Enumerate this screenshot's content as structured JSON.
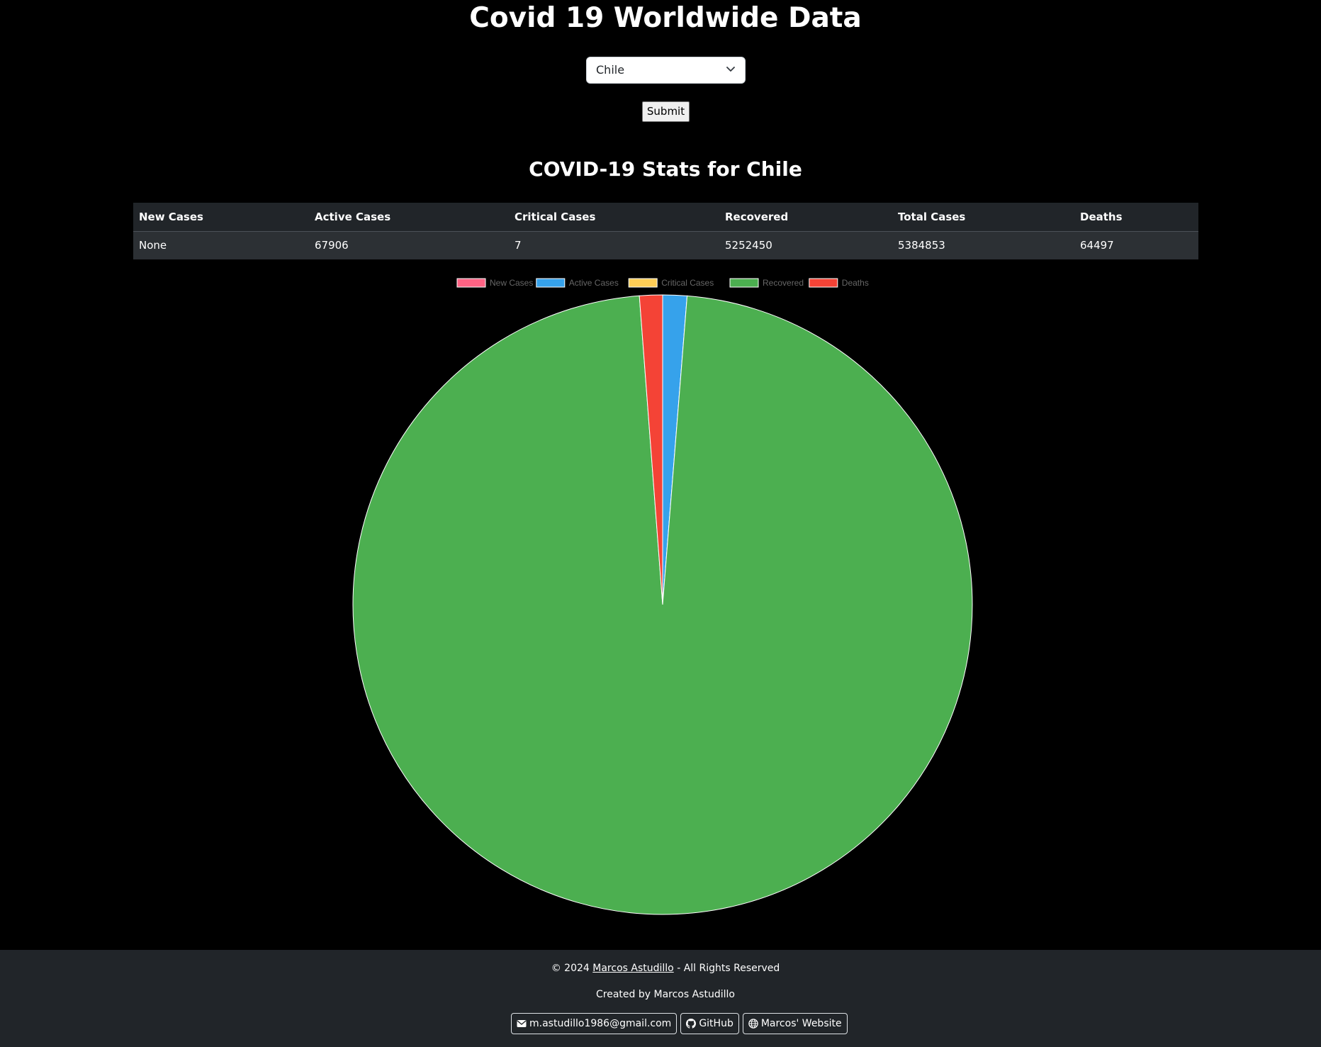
{
  "header": {
    "title": "Covid 19 Worldwide Data"
  },
  "form": {
    "selected_country": "Chile",
    "submit_label": "Submit"
  },
  "stats": {
    "title": "COVID-19 Stats for Chile",
    "columns": [
      "New Cases",
      "Active Cases",
      "Critical Cases",
      "Recovered",
      "Total Cases",
      "Deaths"
    ],
    "row": [
      "None",
      "67906",
      "7",
      "5252450",
      "5384853",
      "64497"
    ]
  },
  "chart_data": {
    "type": "pie",
    "title": "",
    "categories": [
      "New Cases",
      "Active Cases",
      "Critical Cases",
      "Recovered",
      "Deaths"
    ],
    "values": [
      0,
      67906,
      7,
      5252450,
      64497
    ],
    "colors": [
      "#ff6384",
      "#36a2eb",
      "#ffce56",
      "#4caf50",
      "#f44336"
    ],
    "legend_position": "top"
  },
  "footer": {
    "copyright_prefix": "© 2024",
    "author_link": "Marcos Astudillo",
    "copyright_suffix": "- All Rights Reserved",
    "created_by": "Created by Marcos Astudillo",
    "email_label": "m.astudillo1986@gmail.com",
    "github_label": "GitHub",
    "website_label": "Marcos' Website"
  },
  "icons": {
    "select_chevron": "chevron-down-icon",
    "email": "envelope-icon",
    "github": "github-icon",
    "website": "globe-icon"
  }
}
